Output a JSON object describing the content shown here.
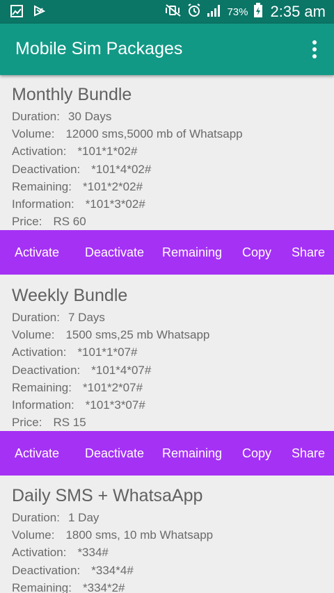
{
  "status_bar": {
    "battery": "73%",
    "time": "2:35 am",
    "icons": [
      "gallery-icon",
      "download-icon",
      "mute-vibrate-icon",
      "alarm-icon",
      "signal-icon",
      "battery-charging-icon"
    ]
  },
  "app_bar": {
    "title": "Mobile Sim Packages",
    "menu_icon": "overflow-menu-icon"
  },
  "packages": [
    {
      "title": "Monthly Bundle",
      "rows": [
        {
          "label": "Duration:",
          "value": "30 Days"
        },
        {
          "label": "Volume:",
          "value": "12000 sms,5000 mb of Whatsapp"
        },
        {
          "label": "Activation:",
          "value": "*101*1*02#"
        },
        {
          "label": "Deactivation:",
          "value": "*101*4*02#"
        },
        {
          "label": "Remaining:",
          "value": "*101*2*02#"
        },
        {
          "label": "Information:",
          "value": "*101*3*02#"
        },
        {
          "label": "Price:",
          "value": "RS 60"
        }
      ]
    },
    {
      "title": "Weekly Bundle",
      "rows": [
        {
          "label": "Duration:",
          "value": "7 Days"
        },
        {
          "label": "Volume:",
          "value": "1500 sms,25 mb Whatsapp"
        },
        {
          "label": "Activation:",
          "value": "*101*1*07#"
        },
        {
          "label": "Deactivation:",
          "value": "*101*4*07#"
        },
        {
          "label": "Remaining:",
          "value": "*101*2*07#"
        },
        {
          "label": "Information:",
          "value": "*101*3*07#"
        },
        {
          "label": "Price:",
          "value": "RS 15"
        }
      ]
    },
    {
      "title": "Daily SMS + WhatsaApp",
      "rows": [
        {
          "label": "Duration:",
          "value": "1 Day"
        },
        {
          "label": "Volume:",
          "value": "1800 sms, 10 mb Whatsapp"
        },
        {
          "label": "Activation:",
          "value": "*334#"
        },
        {
          "label": "Deactivation:",
          "value": "*334*4#"
        },
        {
          "label": "Remaining:",
          "value": "*334*2#"
        }
      ]
    }
  ],
  "actions": {
    "activate": "Activate",
    "deactivate": "Deactivate",
    "remaining": "Remaining",
    "copy": "Copy",
    "share": "Share"
  },
  "colors": {
    "status_bar": "#0b7566",
    "app_bar": "#129986",
    "action_bar": "#a531f5",
    "background": "#eeeeee"
  }
}
